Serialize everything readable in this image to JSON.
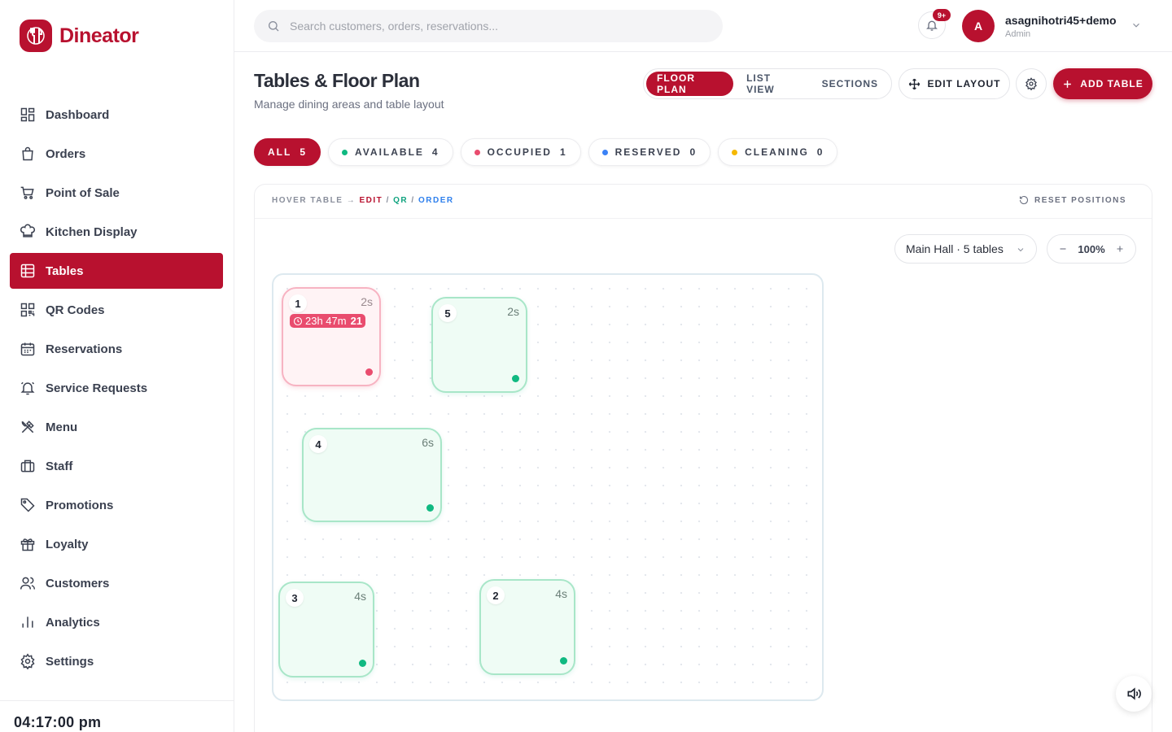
{
  "app": {
    "name": "Dineator"
  },
  "colors": {
    "brand": "#b8112f",
    "available": "#10b981",
    "occupied": "#e94c6e",
    "reserved": "#3b82f6",
    "cleaning": "#f5b800"
  },
  "sidebar": {
    "items": [
      {
        "label": "Dashboard",
        "icon": "dashboard-icon"
      },
      {
        "label": "Orders",
        "icon": "orders-icon"
      },
      {
        "label": "Point of Sale",
        "icon": "cart-icon"
      },
      {
        "label": "Kitchen Display",
        "icon": "chef-hat-icon"
      },
      {
        "label": "Tables",
        "icon": "table-icon",
        "active": true
      },
      {
        "label": "QR Codes",
        "icon": "qr-icon"
      },
      {
        "label": "Reservations",
        "icon": "calendar-icon"
      },
      {
        "label": "Service Requests",
        "icon": "bell-ring-icon"
      },
      {
        "label": "Menu",
        "icon": "utensils-icon"
      },
      {
        "label": "Staff",
        "icon": "briefcase-icon"
      },
      {
        "label": "Promotions",
        "icon": "tag-icon"
      },
      {
        "label": "Loyalty",
        "icon": "gift-icon"
      },
      {
        "label": "Customers",
        "icon": "users-icon"
      },
      {
        "label": "Analytics",
        "icon": "bar-chart-icon"
      },
      {
        "label": "Settings",
        "icon": "gear-icon"
      }
    ],
    "clock": "04:17:00 pm"
  },
  "topbar": {
    "search_placeholder": "Search customers, orders, reservations...",
    "notification_badge": "9+",
    "user": {
      "initial": "A",
      "name": "asagnihotri45+demo",
      "role": "Admin"
    }
  },
  "header": {
    "title": "Tables & Floor Plan",
    "subtitle": "Manage dining areas and table layout",
    "views": [
      {
        "label": "FLOOR PLAN",
        "active": true
      },
      {
        "label": "LIST VIEW",
        "active": false
      },
      {
        "label": "SECTIONS",
        "active": false
      }
    ],
    "edit_layout": "EDIT LAYOUT",
    "add_table": "ADD TABLE"
  },
  "filters": [
    {
      "label": "ALL",
      "count": "5",
      "active": true
    },
    {
      "label": "AVAILABLE",
      "count": "4",
      "color": "#10b981"
    },
    {
      "label": "OCCUPIED",
      "count": "1",
      "color": "#e94c6e"
    },
    {
      "label": "RESERVED",
      "count": "0",
      "color": "#3b82f6"
    },
    {
      "label": "CLEANING",
      "count": "0",
      "color": "#f5b800"
    }
  ],
  "floor": {
    "hint_prefix": "HOVER TABLE →",
    "hint_edit": "EDIT",
    "hint_sep": "/",
    "hint_qr": "QR",
    "hint_order": "ORDER",
    "reset": "RESET POSITIONS",
    "section": "Main Hall · 5 tables",
    "zoom": "100%",
    "tables": [
      {
        "number": "1",
        "seats": "2s",
        "status": "occupied",
        "timer": "23h 47m",
        "timer_count": "21"
      },
      {
        "number": "5",
        "seats": "2s",
        "status": "available"
      },
      {
        "number": "4",
        "seats": "6s",
        "status": "available"
      },
      {
        "number": "3",
        "seats": "4s",
        "status": "available"
      },
      {
        "number": "2",
        "seats": "4s",
        "status": "available"
      }
    ]
  }
}
